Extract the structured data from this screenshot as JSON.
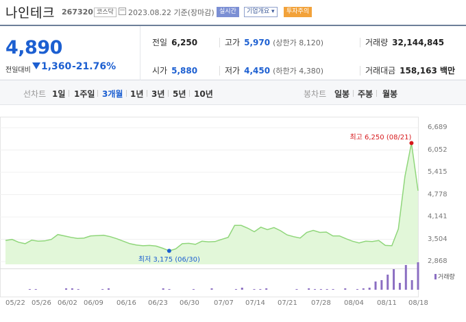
{
  "header": {
    "name": "나인테크",
    "code": "267320",
    "market": "코스닥",
    "date": "2023.08.22 기준(장마감)",
    "realtime_btn": "실시간",
    "company_info_btn": "기업개요 ▾",
    "warning_badge": "투자주의"
  },
  "summary": {
    "price": "4,890",
    "change_label": "전일대비",
    "change": "1,360",
    "change_rate": "-21.76%",
    "prev_close_label": "전일",
    "prev_close": "6,250",
    "high_label": "고가",
    "high": "5,970",
    "upper_limit_label": "(상한가",
    "upper_limit": "8,120)",
    "volume_label": "거래량",
    "volume": "32,144,845",
    "open_label": "시가",
    "open": "5,880",
    "low_label": "저가",
    "low": "4,450",
    "lower_limit_label": "(하한가",
    "lower_limit": "4,380)",
    "amount_label": "거래대금",
    "amount": "158,163 백만"
  },
  "period": {
    "label": "선차트",
    "items": [
      "1일",
      "1주일",
      "3개월",
      "1년",
      "3년",
      "5년",
      "10년"
    ],
    "active": "3개월",
    "candle_label": "봉차트",
    "candle_items": [
      "일봉",
      "주봉",
      "월봉"
    ]
  },
  "colors": {
    "accent": "#1c5fd1",
    "up": "#d7191c",
    "line": "#8fd67a",
    "fill": "#e2f7d9",
    "volume": "#8b6ec2"
  },
  "chart_data": {
    "type": "area",
    "x_ticks": [
      "05/22",
      "05/26",
      "06/02",
      "06/09",
      "06/16",
      "06/23",
      "06/30",
      "07/07",
      "07/14",
      "07/21",
      "07/28",
      "08/04",
      "08/11",
      "08/18"
    ],
    "y_ticks": [
      "6,689",
      "6,052",
      "5,415",
      "4,778",
      "4,141",
      "3,504",
      "2,868"
    ],
    "ylim": [
      2868,
      6689
    ],
    "price": [
      3470,
      3500,
      3420,
      3380,
      3480,
      3450,
      3460,
      3500,
      3640,
      3600,
      3560,
      3530,
      3540,
      3600,
      3610,
      3620,
      3580,
      3520,
      3450,
      3380,
      3340,
      3320,
      3330,
      3310,
      3250,
      3175,
      3230,
      3380,
      3390,
      3360,
      3450,
      3430,
      3440,
      3500,
      3560,
      3900,
      3900,
      3820,
      3720,
      3850,
      3780,
      3840,
      3750,
      3630,
      3580,
      3540,
      3700,
      3760,
      3700,
      3710,
      3600,
      3600,
      3520,
      3450,
      3400,
      3450,
      3440,
      3470,
      3330,
      3320,
      3800,
      5300,
      6250,
      4890
    ],
    "volume": [
      0,
      0,
      0,
      0,
      1,
      1,
      0,
      0,
      0,
      0,
      2,
      2,
      1,
      0,
      0,
      0,
      1,
      2,
      0,
      0,
      0,
      0,
      0,
      0,
      0,
      0,
      2,
      1,
      0,
      0,
      0,
      1,
      0,
      0,
      2,
      0,
      0,
      0,
      1,
      3,
      0,
      1,
      1,
      2,
      0,
      0,
      0,
      0,
      1,
      0,
      2,
      1,
      1,
      1,
      1,
      0,
      2,
      0,
      1,
      2,
      3,
      12,
      14,
      22,
      30,
      10,
      36,
      14,
      40
    ],
    "legend": "거래량",
    "max": {
      "label": "최고 6,250 (08/21)",
      "value": 6250
    },
    "min": {
      "label": "최저 3,175 (06/30)",
      "value": 3175
    }
  }
}
